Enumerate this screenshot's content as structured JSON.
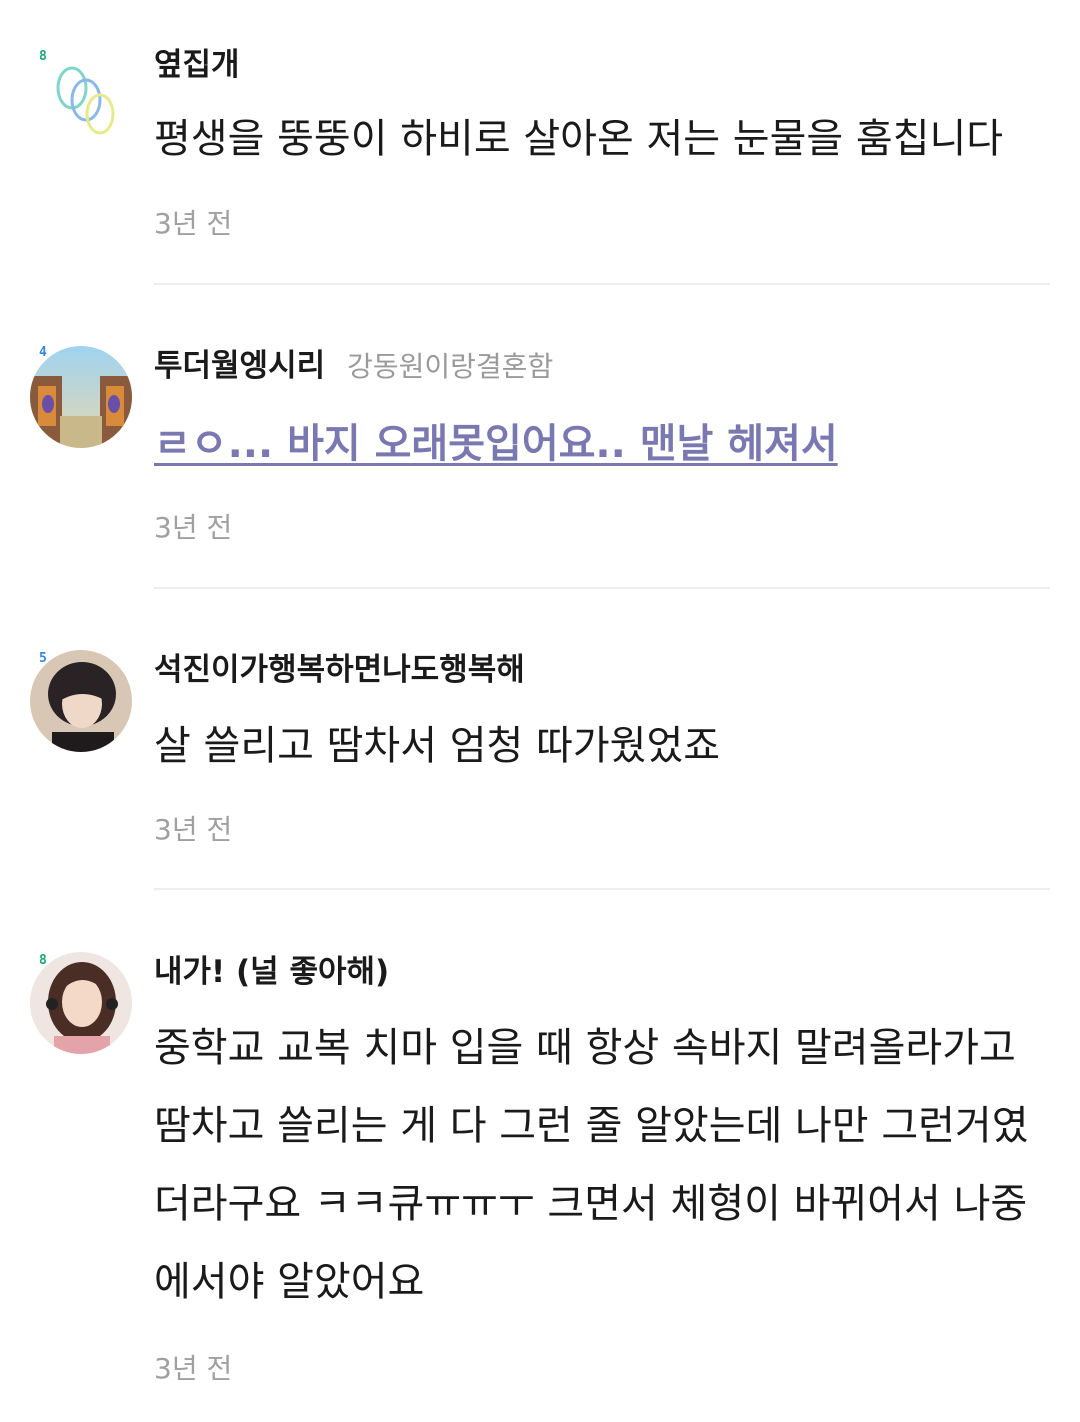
{
  "comments": [
    {
      "level": "8",
      "level_color": "#1aa878",
      "avatar": "ring-logo-avatar",
      "nickname": "옆집개",
      "subnickname": "",
      "text": "평생을 뚱뚱이 하비로 살아온 저는 눈물을 훔칩니다",
      "is_link": false,
      "time": "3년 전"
    },
    {
      "level": "4",
      "level_color": "#3a86d4",
      "avatar": "illustration-avatar",
      "nickname": "투더월엥시리",
      "subnickname": "강동원이랑결혼함",
      "text": "ㄹㅇ... 바지 오래못입어요.. 맨날 헤져서",
      "is_link": true,
      "time": "3년 전"
    },
    {
      "level": "5",
      "level_color": "#3a86d4",
      "avatar": "person-photo-avatar",
      "nickname": "석진이가행복하면나도행복해",
      "subnickname": "",
      "text": "살 쓸리고 땀차서 엄청 따가웠었죠",
      "is_link": false,
      "time": "3년 전"
    },
    {
      "level": "8",
      "level_color": "#1aa878",
      "avatar": "person-photo-avatar",
      "nickname": "내가! (널 좋아해)",
      "subnickname": "",
      "text": "중학교 교복 치마 입을 때 항상 속바지 말려올라가고 땀차고 쓸리는 게 다 그런 줄 알았는데 나만 그런거였더라구요 ㅋㅋ큐ㅠㅠㅜ 크면서 체형이 바뀌어서 나중에서야 알았어요",
      "is_link": false,
      "time": "3년 전"
    }
  ]
}
